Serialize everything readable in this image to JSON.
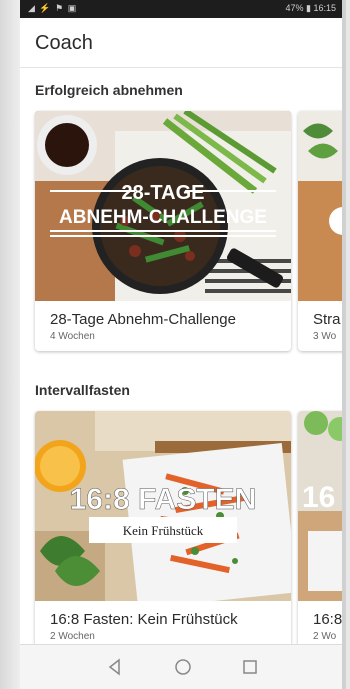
{
  "statusbar": {
    "left": "◢ ⚡ ⚑ ▣",
    "right": "47% ▮ 16:15"
  },
  "app": {
    "title": "Coach"
  },
  "sections": [
    {
      "title": "Erfolgreich abnehmen",
      "cards": [
        {
          "overlay_line1": "28-TAGE",
          "overlay_line2": "ABNEHM-CHALLENGE",
          "title": "28-Tage Abnehm-Challenge",
          "subtitle": "4 Wochen"
        },
        {
          "title": "Stra",
          "subtitle": "3 Wo"
        }
      ]
    },
    {
      "title": "Intervallfasten",
      "cards": [
        {
          "overlay_line1": "16:8 FASTEN",
          "overlay_line2": "Kein Frühstück",
          "title": "16:8 Fasten: Kein Frühstück",
          "subtitle": "2 Wochen"
        },
        {
          "overlay_line1": "16",
          "title": "16:8",
          "subtitle": "2 Wo"
        }
      ]
    }
  ],
  "navbar": {
    "icons": [
      "back-icon",
      "home-icon",
      "recents-icon"
    ]
  }
}
